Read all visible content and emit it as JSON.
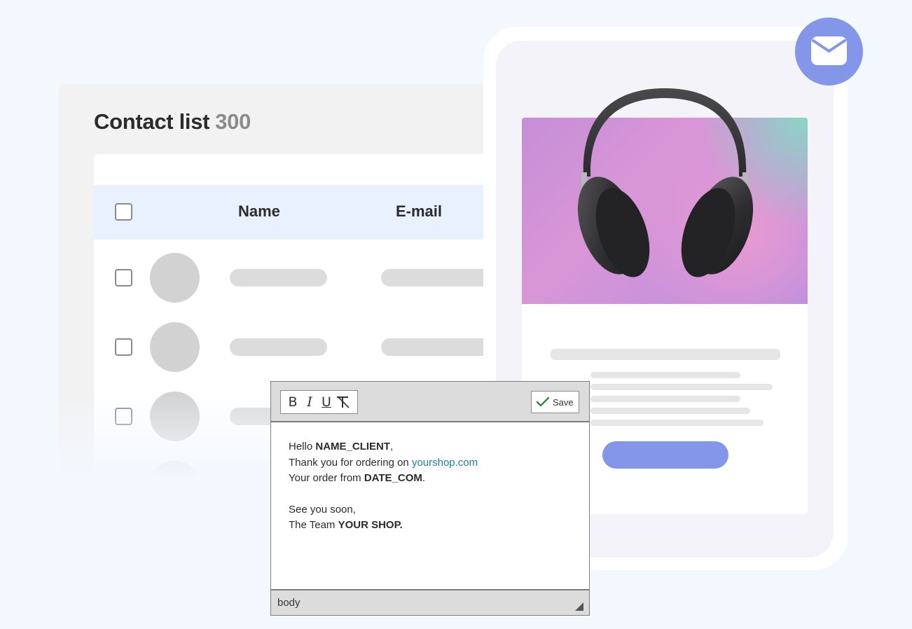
{
  "contact_list": {
    "title": "Contact list",
    "count": "300",
    "columns": {
      "name": "Name",
      "email": "E-mail"
    }
  },
  "editor": {
    "toolbar": {
      "bold_icon": "B",
      "italic_icon": "I",
      "underline_icon": "U",
      "clear_format_icon": "T",
      "save_label": "Save"
    },
    "body": {
      "line1_prefix": "Hello ",
      "line1_var": "NAME_CLIENT",
      "line1_suffix": ",",
      "line2_prefix": "Thank you for ordering on ",
      "line2_link": "yourshop.com",
      "line3_prefix": "Your order from ",
      "line3_var": "DATE_COM",
      "line3_suffix": ".",
      "line4": "See you soon,",
      "line5_prefix": "The Team ",
      "line5_var": "YOUR SHOP."
    },
    "status": "body"
  },
  "email_preview": {
    "product_image": "headphones",
    "icon": "envelope-icon"
  },
  "colors": {
    "accent": "#8496ea",
    "header_row": "#e8f1fd",
    "link": "#1a7fa6"
  }
}
